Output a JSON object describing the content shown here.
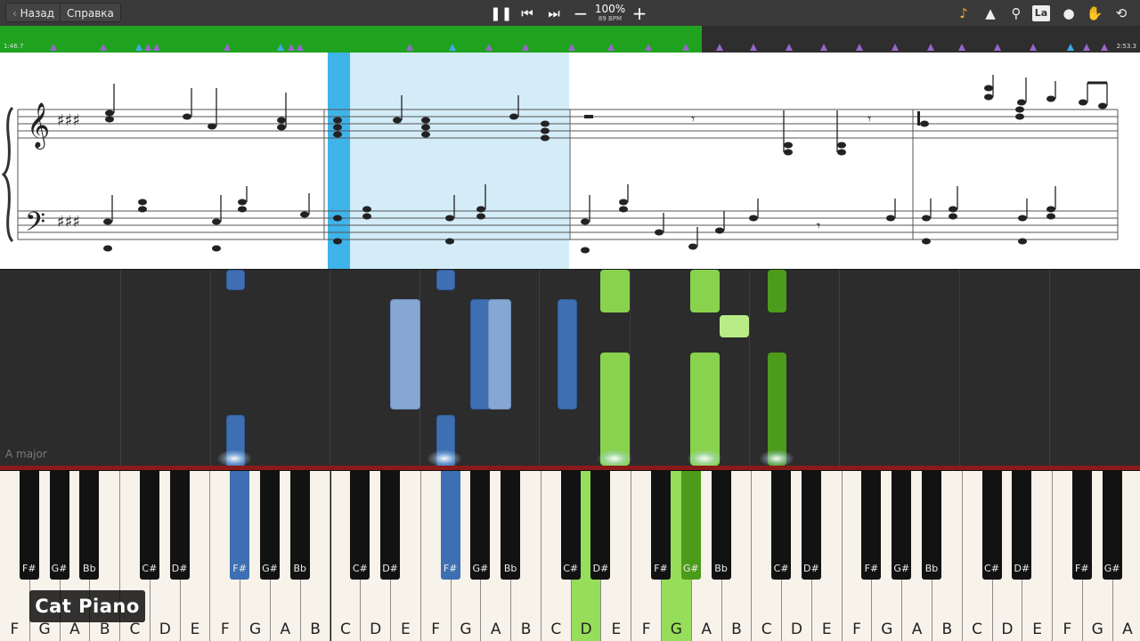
{
  "toolbar": {
    "back_label": "Назад",
    "help_label": "Справка",
    "zoom": "100%",
    "tempo": "89 BPM"
  },
  "timeline": {
    "start_time": "1:46.7",
    "end_time": "2:53.3",
    "progress": 0.616
  },
  "roll": {
    "key_signature": "A major"
  },
  "keyboard": {
    "white_keys": [
      "F",
      "G",
      "A",
      "B",
      "C",
      "D",
      "E",
      "F",
      "G",
      "A",
      "B",
      "C",
      "D",
      "E",
      "F",
      "G",
      "A",
      "B",
      "C",
      "D",
      "E",
      "F",
      "G",
      "A",
      "B",
      "C",
      "D",
      "E",
      "F",
      "G",
      "A",
      "B",
      "C",
      "D",
      "E",
      "F",
      "G",
      "A"
    ],
    "black_keys": [
      "F#",
      "G#",
      "Bb",
      "C#",
      "D#",
      "F#",
      "G#",
      "Bb",
      "C#",
      "D#",
      "F#",
      "G#",
      "Bb",
      "C#",
      "D#",
      "F#",
      "G#",
      "Bb",
      "C#",
      "D#",
      "F#",
      "G#",
      "Bb",
      "C#",
      "D#",
      "F#",
      "G#"
    ]
  },
  "logo_text": "Cat Piano",
  "colors": {
    "left_hand": "#3d6fb2",
    "right_hand": "#89d24e",
    "progress": "#1fa31f",
    "cursor": "#3fb4ea"
  }
}
